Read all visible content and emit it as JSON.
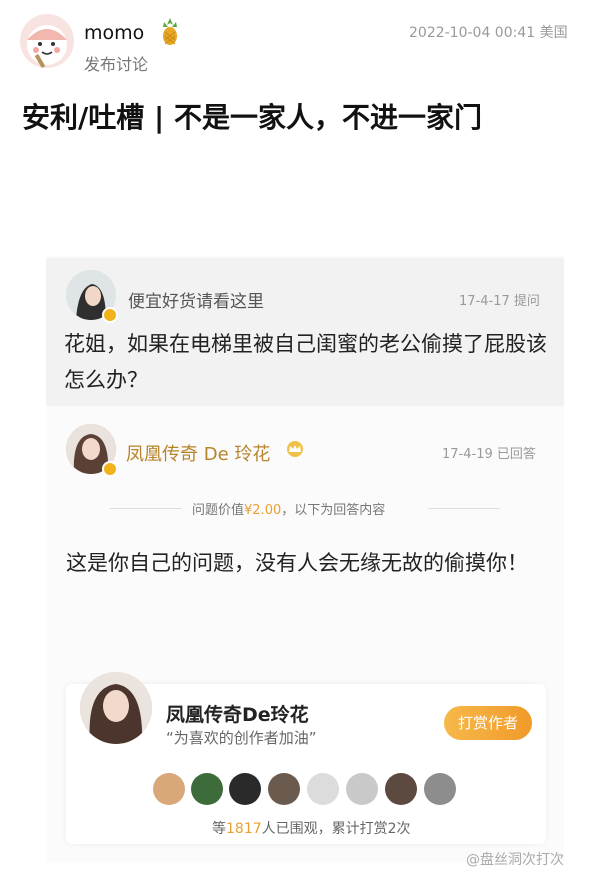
{
  "post": {
    "username": "momo",
    "subtitle": "发布讨论",
    "timestamp": "2022-10-04 00:41 美国",
    "title": "安利/吐槽 | 不是一家人，不进一家门"
  },
  "embedded": {
    "question": {
      "asker": "便宜好货请看这里",
      "date": "17-4-17 提问",
      "text": "花姐，如果在电梯里被自己闺蜜的老公偷摸了屁股该怎么办？"
    },
    "answer": {
      "answerer": "凤凰传奇 De 玲花",
      "date": "17-4-19 已回答",
      "price_prefix": "问题价值",
      "price_value": "¥2.00",
      "price_suffix": "，以下为回答内容",
      "text": "这是你自己的问题，没有人会无缘无故的偷摸你！"
    },
    "tip": {
      "name": "凤凰传奇De玲花",
      "quote": "“为喜欢的创作者加油”",
      "button": "打赏作者",
      "stats_prefix": "等",
      "stats_count": "1817",
      "stats_suffix": "人已围观，累计打赏2次"
    }
  },
  "watermark": "@盘丝洞次打次",
  "colors": {
    "accent_gold": "#b7842b",
    "accent_orange": "#f09a2a",
    "price": "#e8a030"
  },
  "icons": [
    "pineapple-icon",
    "crown-icon",
    "verified-badge-icon"
  ]
}
